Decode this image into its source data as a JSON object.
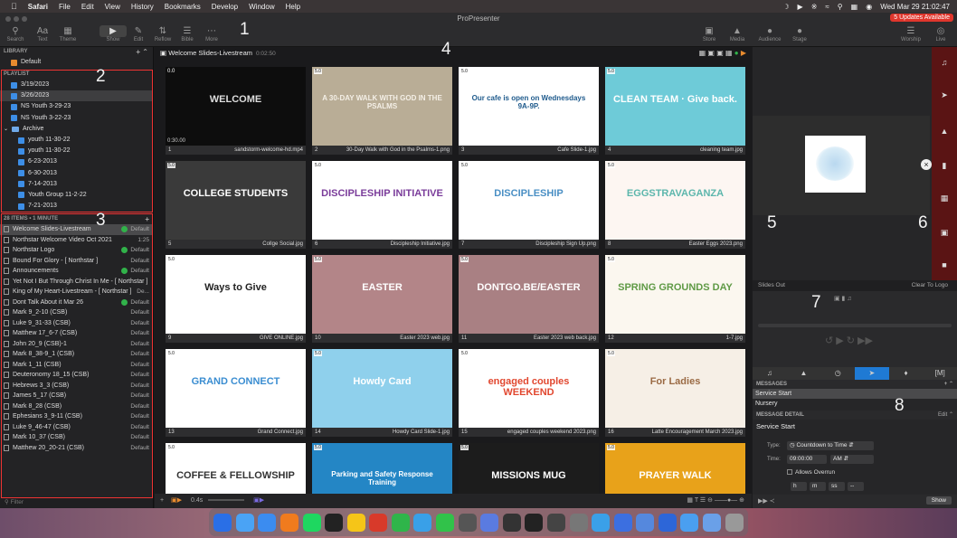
{
  "menubar": {
    "app": "Safari",
    "items": [
      "File",
      "Edit",
      "View",
      "History",
      "Bookmarks",
      "Develop",
      "Window",
      "Help"
    ],
    "clock": "Wed Mar 29  21:02:47"
  },
  "window": {
    "title": "ProPresenter",
    "update_badge": "5 Updates Available"
  },
  "toolbar": {
    "left": [
      "Search",
      "Text",
      "Theme",
      "Show",
      "Edit",
      "Reflow",
      "Bible",
      "More"
    ],
    "right": [
      "Store",
      "Media",
      "Audience",
      "Stage",
      "Worship",
      "Live"
    ]
  },
  "library": {
    "header": "LIBRARY",
    "items": [
      "Default"
    ]
  },
  "playlist": {
    "header": "PLAYLIST",
    "items": [
      {
        "label": "3/19/2023",
        "indent": 1,
        "kind": "doc"
      },
      {
        "label": "3/26/2023",
        "indent": 1,
        "kind": "doc",
        "selected": true
      },
      {
        "label": "NS Youth 3-29-23",
        "indent": 1,
        "kind": "doc"
      },
      {
        "label": "NS Youth 3-22-23",
        "indent": 1,
        "kind": "doc"
      },
      {
        "label": "Archive",
        "indent": 0,
        "kind": "folder"
      },
      {
        "label": "youth 11-30-22",
        "indent": 2,
        "kind": "doc"
      },
      {
        "label": "youth 11-30-22",
        "indent": 2,
        "kind": "doc"
      },
      {
        "label": "6-23-2013",
        "indent": 2,
        "kind": "doc"
      },
      {
        "label": "6-30-2013",
        "indent": 2,
        "kind": "doc"
      },
      {
        "label": "7-14-2013",
        "indent": 2,
        "kind": "doc"
      },
      {
        "label": "Youth Group 11-2-22",
        "indent": 2,
        "kind": "doc"
      },
      {
        "label": "7-21-2013",
        "indent": 2,
        "kind": "doc"
      }
    ]
  },
  "items_header": "28 ITEMS • 1 MINUTE",
  "items": [
    {
      "name": "Welcome Slides-Livestream",
      "arr": "Default",
      "green": true,
      "selected": true
    },
    {
      "name": "Northstar Welcome Video Oct 2021",
      "arr": "1:25"
    },
    {
      "name": "Northstar Logo",
      "arr": "Default",
      "green": true
    },
    {
      "name": "Bound For Glory - [ Northstar ]",
      "arr": "Default"
    },
    {
      "name": "Announcements",
      "arr": "Default",
      "green": true
    },
    {
      "name": "Yet Not I But Through Christ In Me - [ Northstar ]",
      "arr": ""
    },
    {
      "name": "King of My Heart-Livestream - [ Northstar ]",
      "arr": "De..."
    },
    {
      "name": "Dont Talk About it Mar 26",
      "arr": "Default",
      "green": true
    },
    {
      "name": "Mark 9_2-10 (CSB)",
      "arr": "Default"
    },
    {
      "name": "Luke 9_31-33 (CSB)",
      "arr": "Default"
    },
    {
      "name": "Matthew 17_6-7 (CSB)",
      "arr": "Default"
    },
    {
      "name": "John 20_9 (CSB)-1",
      "arr": "Default"
    },
    {
      "name": "Mark 8_38-9_1 (CSB)",
      "arr": "Default"
    },
    {
      "name": "Mark 1_11 (CSB)",
      "arr": "Default"
    },
    {
      "name": "Deuteronomy 18_15 (CSB)",
      "arr": "Default"
    },
    {
      "name": "Hebrews 3_3 (CSB)",
      "arr": "Default"
    },
    {
      "name": "James 5_17 (CSB)",
      "arr": "Default"
    },
    {
      "name": "Mark 8_28 (CSB)",
      "arr": "Default"
    },
    {
      "name": "Ephesians 3_9-11 (CSB)",
      "arr": "Default"
    },
    {
      "name": "Luke 9_46-47 (CSB)",
      "arr": "Default"
    },
    {
      "name": "Mark 10_37 (CSB)",
      "arr": "Default"
    },
    {
      "name": "Matthew 20_20-21 (CSB)",
      "arr": "Default"
    }
  ],
  "filter_placeholder": "Filter",
  "document": {
    "title": "Welcome Slides-Livestream",
    "duration": "0:02:50"
  },
  "slides": [
    {
      "n": "1",
      "file": "sandstorm-welcome-hd.mp4",
      "tag": "0.0",
      "time": "0:30.00",
      "bg": "#0d0d0d",
      "text": "WELCOME",
      "fg": "#ddd"
    },
    {
      "n": "2",
      "file": "30-Day Walk with God in the Psalms-1.png",
      "tag": "5.0",
      "bg": "#b9ad96",
      "text": "A 30-DAY WALK WITH GOD IN THE PSALMS",
      "fg": "#f4efe6"
    },
    {
      "n": "3",
      "file": "Cafe Slide-1.jpg",
      "tag": "5.0",
      "bg": "#ffffff",
      "text": "Our cafe is open on Wednesdays 9A-9P.",
      "fg": "#1e5a8c"
    },
    {
      "n": "4",
      "file": "cleaning team.jpg",
      "tag": "5.0",
      "bg": "#6ecbd8",
      "text": "CLEAN TEAM · Give back.",
      "fg": "#ffffff"
    },
    {
      "n": "5",
      "file": "Collge Social.jpg",
      "tag": "5.0",
      "bg": "#3a3a3a",
      "text": "COLLEGE STUDENTS",
      "fg": "#ffffff"
    },
    {
      "n": "6",
      "file": "Discipleship Initiative.jpg",
      "tag": "5.0",
      "bg": "#ffffff",
      "text": "DISCIPLESHIP INITIATIVE",
      "fg": "#7a3c9a"
    },
    {
      "n": "7",
      "file": "Discipleship Sign Up.png",
      "tag": "5.0",
      "bg": "#ffffff",
      "text": "DISCIPLESHIP",
      "fg": "#4a8fc4"
    },
    {
      "n": "8",
      "file": "Easter Eggs 2023.png",
      "tag": "5.0",
      "bg": "#fdf6f2",
      "text": "EGGSTRAVAGANZA",
      "fg": "#5cb6ac"
    },
    {
      "n": "9",
      "file": "GIVE ONLINE.jpg",
      "tag": "5.0",
      "bg": "#ffffff",
      "text": "Ways to Give",
      "fg": "#222222"
    },
    {
      "n": "10",
      "file": "Easter 2023 web.jpg",
      "tag": "5.0",
      "bg": "#b38588",
      "text": "EASTER",
      "fg": "#ffffff"
    },
    {
      "n": "11",
      "file": "Easter 2023 web back.jpg",
      "tag": "5.0",
      "bg": "#a98083",
      "text": "DONTGO.BE/EASTER",
      "fg": "#ffffff"
    },
    {
      "n": "12",
      "file": "1-7.jpg",
      "tag": "5.0",
      "bg": "#fbf7ef",
      "text": "SPRING GROUNDS DAY",
      "fg": "#5f9a45"
    },
    {
      "n": "13",
      "file": "Grand Connect.jpg",
      "tag": "5.0",
      "bg": "#ffffff",
      "text": "GRAND CONNECT",
      "fg": "#3a8dd1"
    },
    {
      "n": "14",
      "file": "Howdy Card Slide-1.jpg",
      "tag": "5.0",
      "bg": "#8fd0ec",
      "text": "Howdy Card",
      "fg": "#ffffff"
    },
    {
      "n": "15",
      "file": "engaged couples weekend 2023.png",
      "tag": "5.0",
      "bg": "#ffffff",
      "text": "engaged couples WEEKEND",
      "fg": "#e1472f"
    },
    {
      "n": "16",
      "file": "Latte Encouragement March 2023.jpg",
      "tag": "5.0",
      "bg": "#f6efe6",
      "text": "For Ladies",
      "fg": "#9a6a44"
    },
    {
      "n": "17",
      "file": "",
      "tag": "5.0",
      "bg": "#ffffff",
      "text": "COFFEE & FELLOWSHIP",
      "fg": "#333333"
    },
    {
      "n": "18",
      "file": "",
      "tag": "5.0",
      "bg": "#2486c5",
      "text": "Parking and Safety Response Training",
      "fg": "#ffffff"
    },
    {
      "n": "19",
      "file": "",
      "tag": "5.0",
      "bg": "#1c1c1c",
      "text": "MISSIONS MUG",
      "fg": "#ffffff"
    },
    {
      "n": "20",
      "file": "",
      "tag": "5.0",
      "bg": "#e8a21a",
      "text": "PRAYER WALK",
      "fg": "#ffffff"
    }
  ],
  "center_bottom": {
    "speed": "0.4s"
  },
  "right": {
    "slides_out": "Slides Out",
    "clear_to_logo": "Clear To Logo",
    "messages_header": "MESSAGES",
    "messages": [
      "Service Start",
      "Nursery"
    ],
    "detail_header": "MESSAGE DETAIL",
    "detail_edit": "Edit",
    "detail_title": "Service Start",
    "type_label": "Type:",
    "type_value": "Countdown to Time",
    "time_label": "Time:",
    "time_value": "09:00:00",
    "ampm": "AM",
    "allows_overrun": "Allows Overrun",
    "fmt": [
      "h",
      "m",
      "ss",
      "--"
    ],
    "show_button": "Show"
  },
  "annotations": [
    "1",
    "2",
    "3",
    "4",
    "5",
    "6",
    "7",
    "8"
  ],
  "colors": {
    "accent": "#1f7ad4",
    "green": "#31b24a",
    "red_box": "#ee3333",
    "badge": "#e0362c"
  }
}
